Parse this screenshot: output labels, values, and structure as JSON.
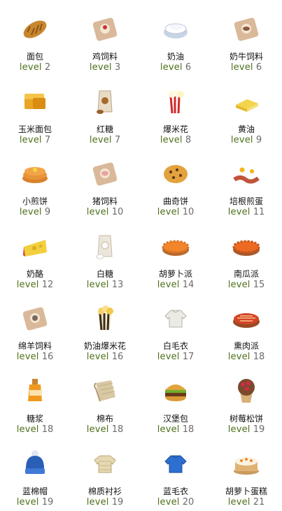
{
  "items": [
    {
      "name": "面包",
      "level_label": "level",
      "level": "2",
      "icon": "bread-icon"
    },
    {
      "name": "鸡饲料",
      "level_label": "level",
      "level": "3",
      "icon": "chicken-feed-icon"
    },
    {
      "name": "奶油",
      "level_label": "level",
      "level": "6",
      "icon": "cream-icon"
    },
    {
      "name": "奶牛饲料",
      "level_label": "level",
      "level": "6",
      "icon": "cow-feed-icon"
    },
    {
      "name": "玉米面包",
      "level_label": "level",
      "level": "7",
      "icon": "cornbread-icon"
    },
    {
      "name": "红糖",
      "level_label": "level",
      "level": "7",
      "icon": "brown-sugar-icon"
    },
    {
      "name": "爆米花",
      "level_label": "level",
      "level": "8",
      "icon": "popcorn-icon"
    },
    {
      "name": "黄油",
      "level_label": "level",
      "level": "9",
      "icon": "butter-icon"
    },
    {
      "name": "小煎饼",
      "level_label": "level",
      "level": "9",
      "icon": "pancake-icon"
    },
    {
      "name": "猪饲料",
      "level_label": "level",
      "level": "10",
      "icon": "pig-feed-icon"
    },
    {
      "name": "曲奇饼",
      "level_label": "level",
      "level": "10",
      "icon": "cookie-icon"
    },
    {
      "name": "培根煎蛋",
      "level_label": "level",
      "level": "11",
      "icon": "bacon-eggs-icon"
    },
    {
      "name": "奶酪",
      "level_label": "level",
      "level": "12",
      "icon": "cheese-icon"
    },
    {
      "name": "白糖",
      "level_label": "level",
      "level": "13",
      "icon": "white-sugar-icon"
    },
    {
      "name": "胡萝卜派",
      "level_label": "level",
      "level": "14",
      "icon": "carrot-pie-icon"
    },
    {
      "name": "南瓜派",
      "level_label": "level",
      "level": "15",
      "icon": "pumpkin-pie-icon"
    },
    {
      "name": "绵羊饲料",
      "level_label": "level",
      "level": "16",
      "icon": "sheep-feed-icon"
    },
    {
      "name": "奶油爆米花",
      "level_label": "level",
      "level": "16",
      "icon": "buttered-popcorn-icon"
    },
    {
      "name": "白毛衣",
      "level_label": "level",
      "level": "17",
      "icon": "white-sweater-icon"
    },
    {
      "name": "熏肉派",
      "level_label": "level",
      "level": "18",
      "icon": "bacon-pie-icon"
    },
    {
      "name": "糖浆",
      "level_label": "level",
      "level": "18",
      "icon": "syrup-icon"
    },
    {
      "name": "棉布",
      "level_label": "level",
      "level": "18",
      "icon": "cotton-fabric-icon"
    },
    {
      "name": "汉堡包",
      "level_label": "level",
      "level": "18",
      "icon": "hamburger-icon"
    },
    {
      "name": "树莓松饼",
      "level_label": "level",
      "level": "19",
      "icon": "raspberry-muffin-icon"
    },
    {
      "name": "蓝棉帽",
      "level_label": "level",
      "level": "19",
      "icon": "blue-woolly-hat-icon"
    },
    {
      "name": "棉质衬衫",
      "level_label": "level",
      "level": "19",
      "icon": "cotton-shirt-icon"
    },
    {
      "name": "蓝毛衣",
      "level_label": "level",
      "level": "20",
      "icon": "blue-sweater-icon"
    },
    {
      "name": "胡萝卜蛋糕",
      "level_label": "level",
      "level": "21",
      "icon": "carrot-cake-icon"
    }
  ]
}
